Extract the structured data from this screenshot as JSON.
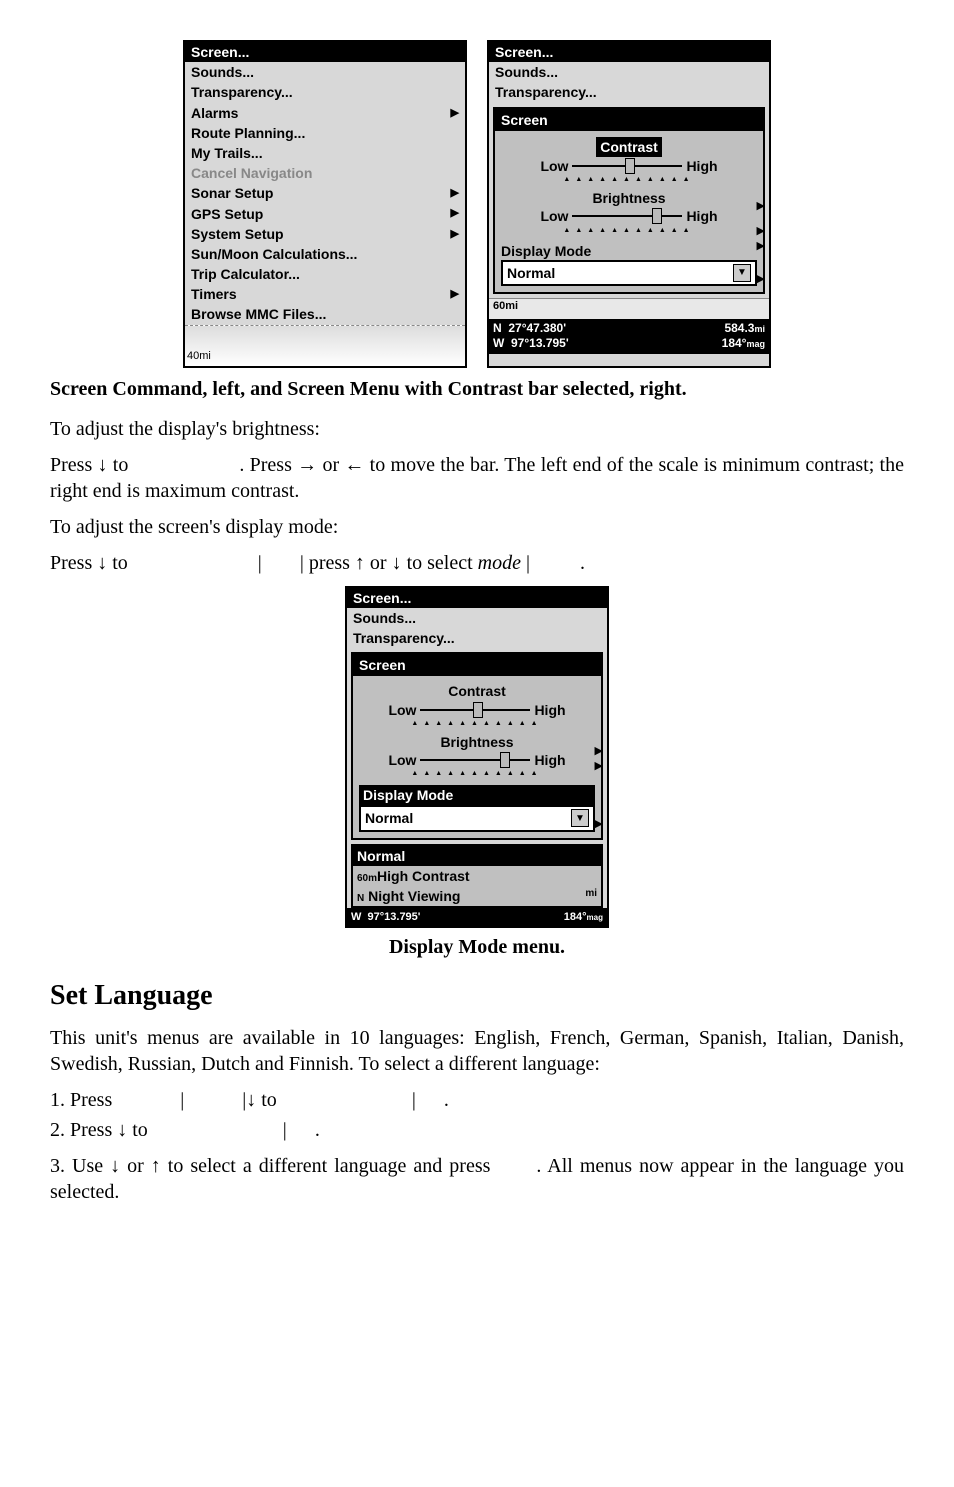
{
  "menu_left": {
    "items": [
      {
        "label": "Screen...",
        "selected": true
      },
      {
        "label": "Sounds..."
      },
      {
        "label": "Transparency..."
      },
      {
        "label": "Alarms",
        "arrow": true
      },
      {
        "label": "Route Planning..."
      },
      {
        "label": "My Trails..."
      },
      {
        "label": "Cancel Navigation",
        "disabled": true
      },
      {
        "label": "Sonar Setup",
        "arrow": true
      },
      {
        "label": "GPS Setup",
        "arrow": true
      },
      {
        "label": "System Setup",
        "arrow": true
      },
      {
        "label": "Sun/Moon Calculations..."
      },
      {
        "label": "Trip Calculator..."
      },
      {
        "label": "Timers",
        "arrow": true
      },
      {
        "label": "Browse MMC Files..."
      }
    ],
    "map_scale": "40mi"
  },
  "menu_right": {
    "top_items": [
      {
        "label": "Screen...",
        "selected": true
      },
      {
        "label": "Sounds..."
      },
      {
        "label": "Transparency..."
      }
    ],
    "panel_title": "Screen",
    "contrast": {
      "label": "Contrast",
      "low": "Low",
      "high": "High",
      "thumb_pct": 48
    },
    "brightness": {
      "label": "Brightness",
      "low": "Low",
      "high": "High",
      "thumb_pct": 72
    },
    "display_mode_label": "Display Mode",
    "display_mode_value": "Normal",
    "map_scale": "60mi",
    "status": {
      "n": "N",
      "w": "W",
      "lat": "27°47.380'",
      "lon": "97°13.795'",
      "dist": "584.3",
      "dist_unit": "mi",
      "brg": "184°",
      "brg_unit": "mag"
    }
  },
  "caption_top": "Screen Command, left, and Screen Menu with Contrast bar selected, right.",
  "para1": "To adjust the display's brightness:",
  "para2a": "Press ↓ to ",
  "para2gap1": "                    ",
  "para2b": ". Press → or ← to move the bar. The left end of the scale is minimum contrast; the right end is maximum contrast.",
  "para3": "To adjust the screen's display mode:",
  "para4a": "Press ↓ to ",
  "para4b": "|",
  "para4c": "| press ↑ or ↓ to select ",
  "para4d": "mode",
  "para4e": "|",
  "para4f": ".",
  "menu_bottom": {
    "top_items": [
      {
        "label": "Screen...",
        "selected": true
      },
      {
        "label": "Sounds..."
      },
      {
        "label": "Transparency..."
      }
    ],
    "panel_title": "Screen",
    "contrast": {
      "label": "Contrast",
      "low": "Low",
      "high": "High",
      "thumb_pct": 48
    },
    "brightness": {
      "label": "Brightness",
      "low": "Low",
      "high": "High",
      "thumb_pct": 72
    },
    "display_mode_label": "Display Mode",
    "display_mode_value": "Normal",
    "options": [
      "Normal",
      "High Contrast",
      "Night Viewing"
    ],
    "map_scale": "60m",
    "status": {
      "w": "W",
      "lon": "97°13.795'",
      "brg": "184°",
      "brg_unit": "mag",
      "n": "N",
      "mi": "mi"
    }
  },
  "caption_bottom": "Display Mode menu.",
  "heading": "Set Language",
  "para5": "This unit's menus are available in 10 languages: English, French, German, Spanish, Italian, Danish, Swedish, Russian, Dutch and Finnish. To select a different language:",
  "step1a": "1. Press ",
  "step1b": "|",
  "step1c": "|↓ to ",
  "step1d": "|",
  "step1e": ".",
  "step2a": "2. Press ↓ to ",
  "step2b": "|",
  "step2c": ".",
  "step3a": "3. Use ↓ or ↑ to select a different language and press ",
  "step3b": ". All menus now appear in the language you selected."
}
